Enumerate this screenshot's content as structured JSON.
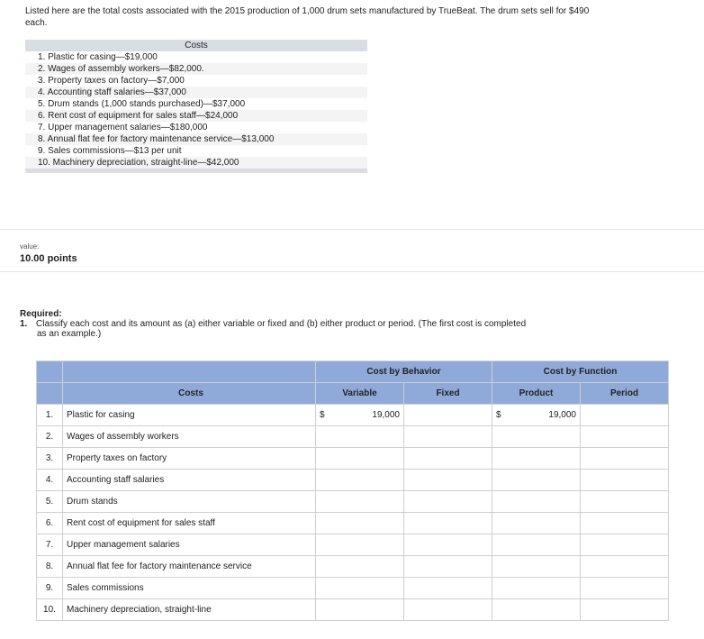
{
  "intro": "Listed here are the total costs associated with the 2015 production of 1,000 drum sets manufactured by TrueBeat. The drum sets sell for $490 each.",
  "costs_box": {
    "header": "Costs",
    "items": [
      "1. Plastic for casing—$19,000",
      "2. Wages of assembly workers—$82,000.",
      "3. Property taxes on factory—$7,000",
      "4. Accounting staff salaries—$37,000",
      "5. Drum stands (1,000 stands purchased)—$37,000",
      "6. Rent cost of equipment for sales staff—$24,000",
      "7. Upper management salaries—$180,000",
      "8. Annual flat fee for factory maintenance service—$13,000",
      "9. Sales commissions—$13 per unit",
      "10. Machinery depreciation, straight-line—$42,000"
    ]
  },
  "value": {
    "label": "value:",
    "points": "10.00 points"
  },
  "required": {
    "heading": "Required:",
    "number": "1.",
    "line1": "Classify each cost and its amount as (a) either variable or fixed and (b) either product or period. (The first cost is completed",
    "line2": "as an example.)"
  },
  "table": {
    "group_behavior": "Cost by Behavior",
    "group_function": "Cost by Function",
    "col_costs": "Costs",
    "col_variable": "Variable",
    "col_fixed": "Fixed",
    "col_product": "Product",
    "col_period": "Period",
    "currency": "$",
    "example_value": "19,000",
    "rows": [
      {
        "no": "1.",
        "cost": "Plastic for casing"
      },
      {
        "no": "2.",
        "cost": "Wages of assembly workers"
      },
      {
        "no": "3.",
        "cost": "Property taxes on factory"
      },
      {
        "no": "4.",
        "cost": "Accounting staff salaries"
      },
      {
        "no": "5.",
        "cost": "Drum stands"
      },
      {
        "no": "6.",
        "cost": "Rent cost of equipment for sales staff"
      },
      {
        "no": "7.",
        "cost": "Upper management salaries"
      },
      {
        "no": "8.",
        "cost": "Annual flat fee for factory maintenance service"
      },
      {
        "no": "9.",
        "cost": "Sales commissions"
      },
      {
        "no": "10.",
        "cost": "Machinery depreciation, straight-line"
      }
    ]
  },
  "colors": {
    "header_blue": "#8fa9d9",
    "input_border": "#f2e34a",
    "costs_header_gray": "#d9dde4"
  }
}
